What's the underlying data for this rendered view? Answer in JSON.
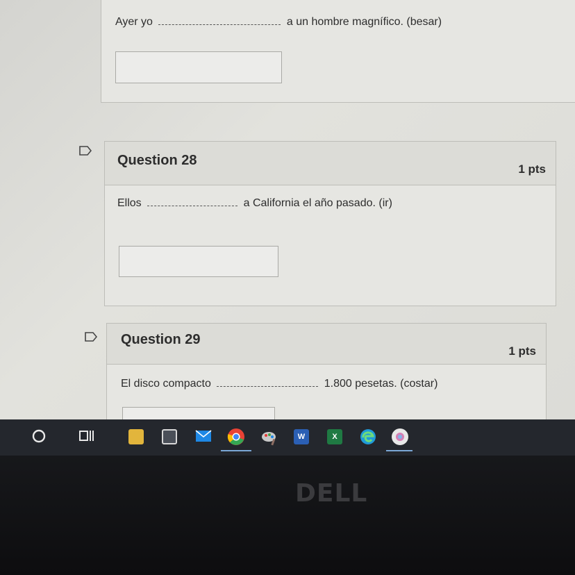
{
  "question27": {
    "prefix": "Ayer yo",
    "suffix": "a un hombre magnífico. (besar)"
  },
  "question28": {
    "title": "Question 28",
    "points": "1 pts",
    "prefix": "Ellos",
    "suffix": "a California el año pasado. (ir)"
  },
  "question29": {
    "title": "Question 29",
    "points": "1 pts",
    "prefix": "El disco compacto",
    "suffix": "1.800 pesetas.  (costar)"
  },
  "taskbar": {
    "icons": [
      "cortana-circle-icon",
      "task-view-icon",
      "file-explorer-icon",
      "store-icon",
      "mail-icon",
      "chrome-icon",
      "paint-icon",
      "word-icon",
      "excel-icon",
      "edge-icon",
      "chromium-icon"
    ],
    "word_letter": "W",
    "excel_letter": "X"
  },
  "monitor": {
    "brand": "DELL"
  }
}
